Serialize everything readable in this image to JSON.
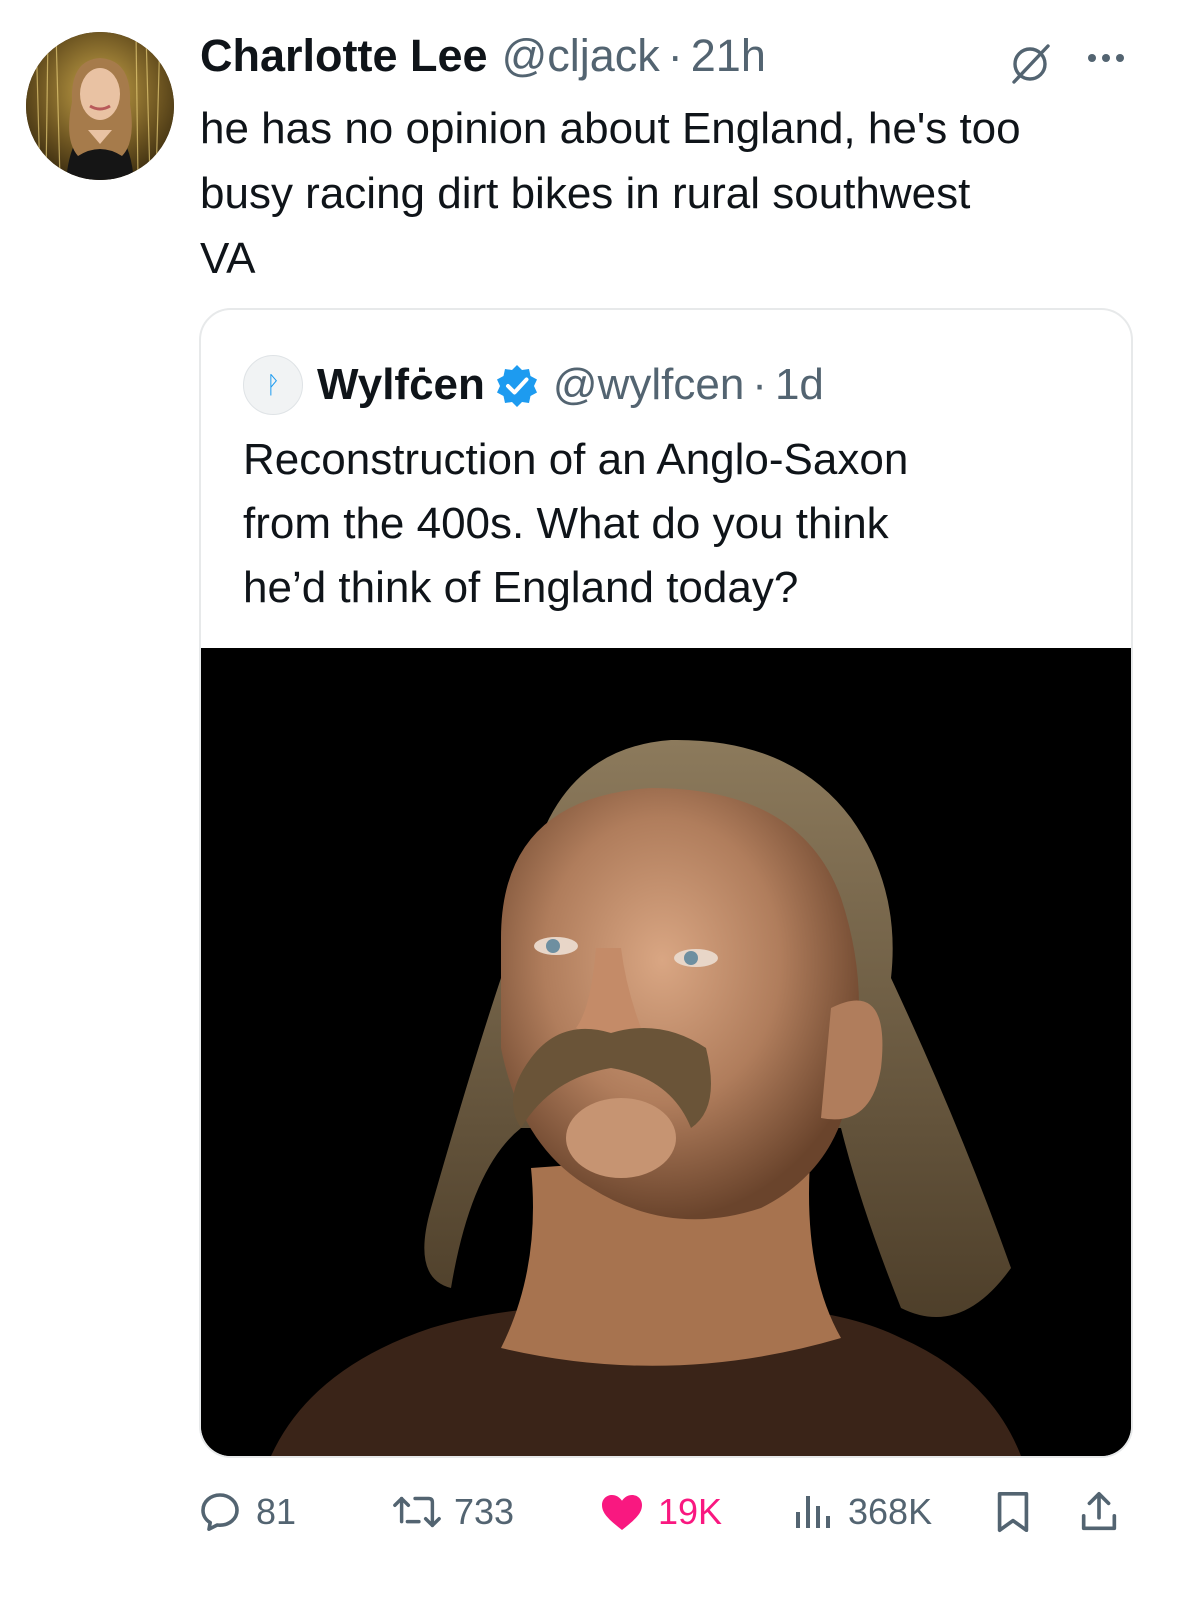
{
  "tweet": {
    "author_name": "Charlotte Lee",
    "author_handle": "@cljack",
    "separator": "·",
    "time": "21h",
    "text_lines": [
      "he has no opinion about England, he's too",
      "busy racing dirt bikes in rural southwest",
      "VA"
    ]
  },
  "quote": {
    "avatar_glyph": "ᚹ",
    "author_name": "Wylfċen",
    "author_handle": "@wylfcen",
    "separator": "·",
    "time": "1d",
    "text_lines": [
      "Reconstruction of an Anglo-Saxon",
      "from the 400s. What do you think",
      "he’d think of England today?"
    ]
  },
  "actions": {
    "replies": "81",
    "retweets": "733",
    "likes": "19K",
    "views": "368K"
  },
  "icons": {
    "reply": "reply-icon",
    "retweet": "retweet-icon",
    "like": "heart-icon",
    "views": "views-icon",
    "bookmark": "bookmark-icon",
    "share": "share-icon",
    "grok": "grok-icon",
    "more": "more-icon",
    "verified": "verified-badge-icon"
  },
  "colors": {
    "text": "#0f1419",
    "secondary": "#536471",
    "like": "#f91880",
    "verified": "#1d9bf0",
    "border": "#e7e9ea"
  }
}
